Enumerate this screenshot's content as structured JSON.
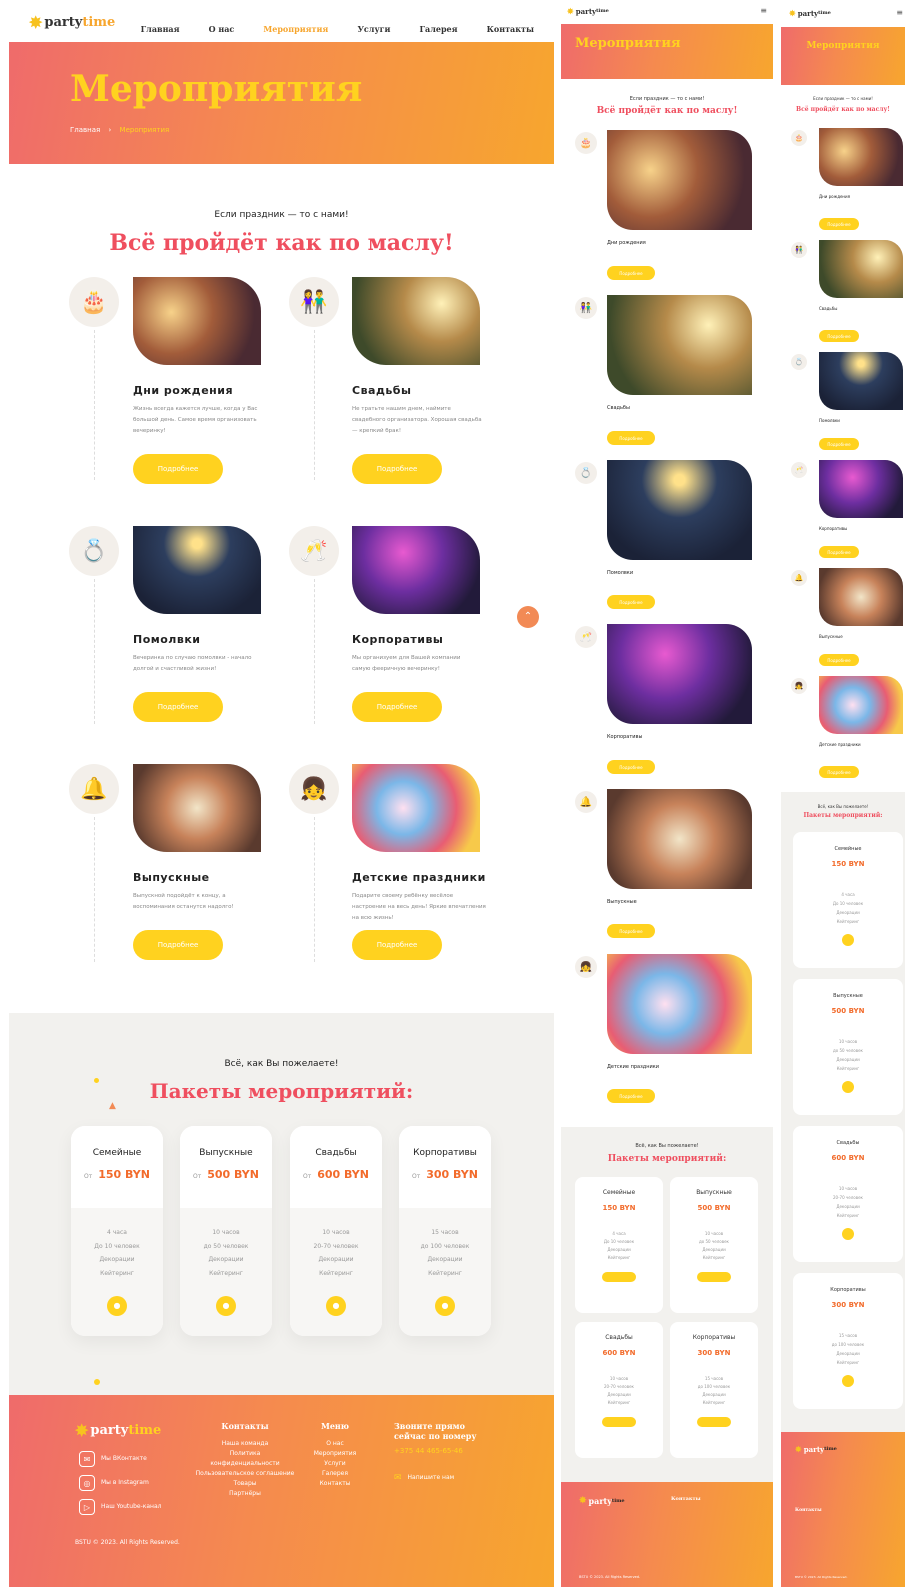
{
  "logo": {
    "party": "party",
    "time": "time"
  },
  "nav": [
    "Главная",
    "О нас",
    "Мероприятия",
    "Услуги",
    "Галерея",
    "Контакты"
  ],
  "hero": {
    "title": "Мероприятия",
    "crumb_home": "Главная",
    "crumb_sep": "›",
    "crumb_current": "Мероприятия"
  },
  "intro": {
    "sub": "Если праздник — то с нами!",
    "title": "Всё пройдёт как по маслу!"
  },
  "events": [
    {
      "title": "Дни рождения",
      "desc": "Жизнь всегда кажется лучше, когда у Вас большой день. Самое время организовать вечеринку!",
      "btn": "Подробнее",
      "icon": "cake-icon"
    },
    {
      "title": "Свадьбы",
      "desc": "Не тратьте нашим днем, наймите свадебного организатора. Хорошая свадьба — крепкий брак!",
      "btn": "Подробнее",
      "icon": "couple-icon"
    },
    {
      "title": "Помолвки",
      "desc": "Вечеринка по случаю помолвки - начало долгой и счастливой жизни!",
      "btn": "Подробнее",
      "icon": "rings-icon"
    },
    {
      "title": "Корпоративы",
      "desc": "Мы организуем для Вашей компании самую фееричную вечеринку!",
      "btn": "Подробнее",
      "icon": "glasses-icon"
    },
    {
      "title": "Выпускные",
      "desc": "Выпускной подойдёт к концу, а воспоминания останутся надолго!",
      "btn": "Подробнее",
      "icon": "bells-icon"
    },
    {
      "title": "Детские праздники",
      "desc": "Подарите своему ребёнку весёлое настроение на весь день! Яркие впечатления на всю жизнь!",
      "btn": "Подробнее",
      "icon": "kids-icon"
    }
  ],
  "packages_section": {
    "sub": "Всё, как Вы пожелаете!",
    "title": "Пакеты мероприятий:"
  },
  "packages": [
    {
      "name": "Семейные",
      "from": "От",
      "price": "150 BYN",
      "f1": "4 часа",
      "f2": "До 10 человек",
      "f3": "Декорации",
      "f4": "Кейтеринг"
    },
    {
      "name": "Выпускные",
      "from": "От",
      "price": "500 BYN",
      "f1": "10 часов",
      "f2": "до 50 человек",
      "f3": "Декорации",
      "f4": "Кейтеринг"
    },
    {
      "name": "Свадьбы",
      "from": "От",
      "price": "600 BYN",
      "f1": "10 часов",
      "f2": "20-70 человек",
      "f3": "Декорации",
      "f4": "Кейтеринг"
    },
    {
      "name": "Корпоративы",
      "from": "От",
      "price": "300 BYN",
      "f1": "15 часов",
      "f2": "до 100 человек",
      "f3": "Декорации",
      "f4": "Кейтеринг"
    }
  ],
  "footer": {
    "social": [
      "Мы ВКонтакте",
      "Мы в Instagram",
      "Наш Youtube-канал"
    ],
    "contacts_title": "Контакты",
    "contacts": [
      "Наша команда",
      "Политика конфиденциальности",
      "Пользовательское соглашение",
      "Товары",
      "Партнёры"
    ],
    "menu_title": "Меню",
    "menu": [
      "О нас",
      "Мероприятия",
      "Услуги",
      "Галерея",
      "Контакты"
    ],
    "call_title": "Звоните прямо сейчас по номеру",
    "phone": "+375 44 465-65-46",
    "write": "Напишите нам",
    "copyright": "BSTU © 2023. All Rights Reserved."
  },
  "colors": {
    "accent": "#ffd21f",
    "heading": "#ef4f5f",
    "price": "#f26b2b"
  }
}
